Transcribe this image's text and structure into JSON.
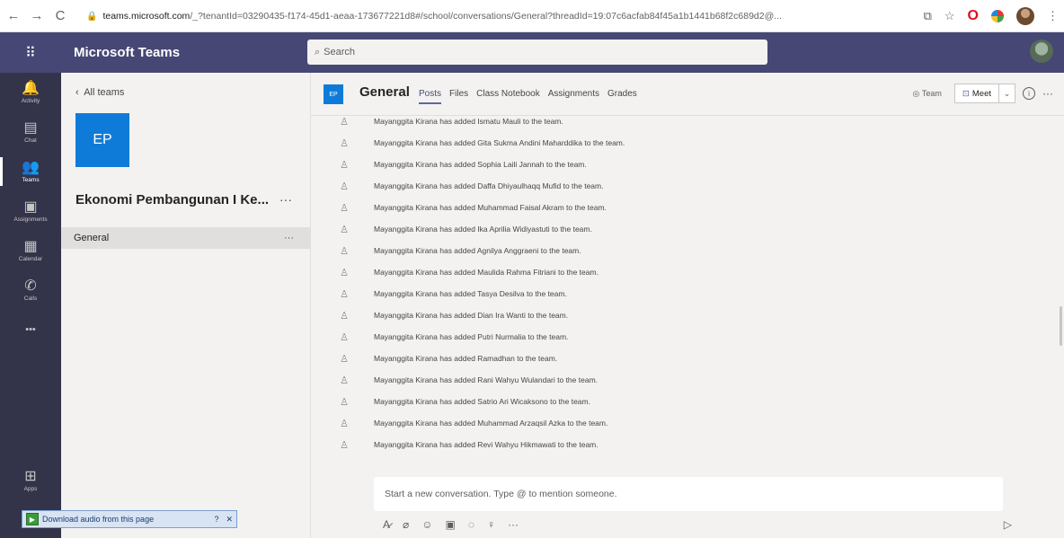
{
  "browser": {
    "back": "←",
    "forward": "→",
    "reload": "C",
    "url_host": "teams.microsoft.com",
    "url_path": "/_?tenantId=03290435-f174-45d1-aeaa-173677221d8#/school/conversations/General?threadId=19:07c6acfab84f45a1b1441b68f2c689d2@..."
  },
  "teams": {
    "app_name": "Microsoft Teams",
    "search_placeholder": "Search"
  },
  "rail": [
    {
      "label": "Activity",
      "icon": "bell-icon",
      "glyph": "🔔"
    },
    {
      "label": "Chat",
      "icon": "chat-icon",
      "glyph": "▤"
    },
    {
      "label": "Teams",
      "icon": "teams-icon",
      "glyph": "👥"
    },
    {
      "label": "Assignments",
      "icon": "assignments-icon",
      "glyph": "▣"
    },
    {
      "label": "Calendar",
      "icon": "calendar-icon",
      "glyph": "▦"
    },
    {
      "label": "Calls",
      "icon": "phone-icon",
      "glyph": "✆"
    },
    {
      "label": "",
      "icon": "more-icon",
      "glyph": "•••"
    },
    {
      "label": "Apps",
      "icon": "apps-icon",
      "glyph": "⊞"
    }
  ],
  "team_panel": {
    "back_label": "All teams",
    "tile_initials": "EP",
    "team_name": "Ekonomi Pembangunan I Ke...",
    "more": "···",
    "channel": "General",
    "channel_more": "···"
  },
  "channel_header": {
    "tile_initials": "EP",
    "title": "General",
    "tabs": [
      "Posts",
      "Files",
      "Class Notebook",
      "Assignments",
      "Grades"
    ],
    "team_button": "Team",
    "meet_button": "Meet",
    "more": "···"
  },
  "messages": [
    "Mayanggita Kirana has added Ismatu Mauli to the team.",
    "Mayanggita Kirana has added Gita Sukma Andini Maharddika to the team.",
    "Mayanggita Kirana has added Sophia Laili Jannah to the team.",
    "Mayanggita Kirana has added Daffa Dhiyaulhaqq Mufid to the team.",
    "Mayanggita Kirana has added Muhammad Faisal Akram to the team.",
    "Mayanggita Kirana has added Ika Aprilia Widiyastuti to the team.",
    "Mayanggita Kirana has added Agnilya Anggraeni to the team.",
    "Mayanggita Kirana has added Maulida Rahma Fitriani to the team.",
    "Mayanggita Kirana has added Tasya Desilva to the team.",
    "Mayanggita Kirana has added Dian Ira Wanti to the team.",
    "Mayanggita Kirana has added Putri Nurmalia to the team.",
    "Mayanggita Kirana has added Ramadhan to the team.",
    "Mayanggita Kirana has added Rani Wahyu Wulandari to the team.",
    "Mayanggita Kirana has added Satrio Ari Wicaksono to the team.",
    "Mayanggita Kirana has added Muhammad Arzaqsil Azka to the team.",
    "Mayanggita Kirana has added Revi Wahyu Hikmawati to the team."
  ],
  "compose": {
    "placeholder": "Start a new conversation. Type @ to mention someone.",
    "more": "···"
  },
  "download_bar": {
    "label": "Download audio from this page",
    "help": "?",
    "close": "✕"
  },
  "colors": {
    "teams_purple": "#464775",
    "rail_dark": "#33344a",
    "tile_blue": "#0f7bd8"
  }
}
